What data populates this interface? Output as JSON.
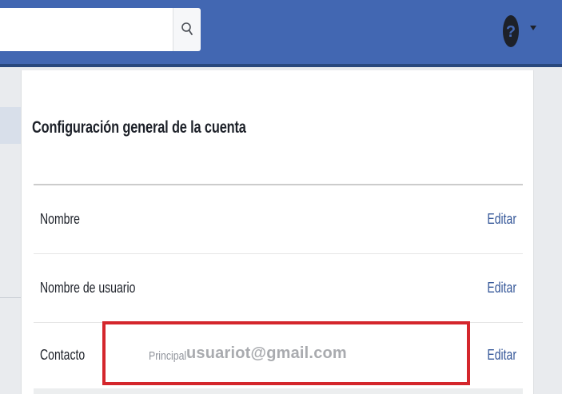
{
  "header": {
    "search": {
      "value": "",
      "placeholder": ""
    },
    "icons": {
      "search": "search-icon",
      "help": "help-icon",
      "menu": "caret-down-icon"
    }
  },
  "settings": {
    "title": "Configuración general de la cuenta",
    "rows": [
      {
        "label": "Nombre",
        "edit_label": "Editar"
      },
      {
        "label": "Nombre de usuario",
        "edit_label": "Editar"
      },
      {
        "label": "Contacto",
        "primary_tag": "Principal",
        "email": "usuariot@gmail.com",
        "edit_label": "Editar"
      }
    ]
  },
  "colors": {
    "topbar": "#4267b2",
    "link": "#365899",
    "highlight": "#d4262c"
  }
}
